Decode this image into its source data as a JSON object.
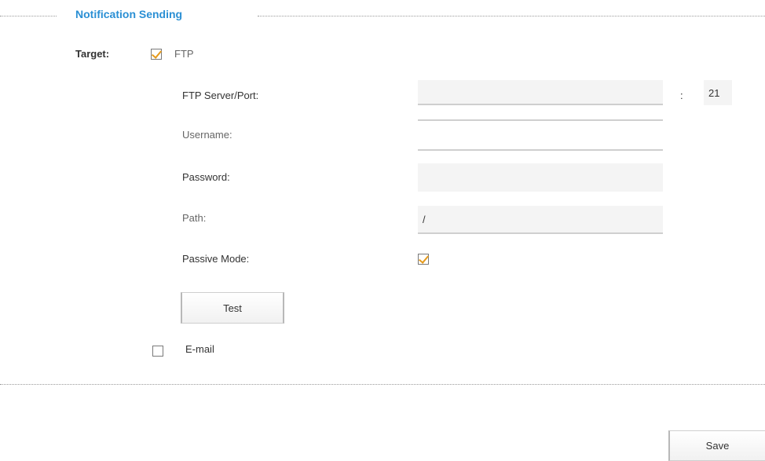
{
  "section": {
    "title": "Notification Sending"
  },
  "target": {
    "label": "Target:"
  },
  "ftp": {
    "label": "FTP",
    "checked": true,
    "server_port_label": "FTP Server/Port:",
    "server_value": "",
    "port_separator": ":",
    "port_value": "21",
    "username_label": "Username:",
    "username_value": "",
    "password_label": "Password:",
    "password_value": "",
    "path_label": "Path:",
    "path_value": "/",
    "passive_mode_label": "Passive Mode:",
    "passive_mode_checked": true,
    "test_button_label": "Test"
  },
  "email": {
    "label": "E-mail",
    "checked": false
  },
  "footer": {
    "save_button_label": "Save"
  },
  "colors": {
    "accent": "#2a8fd4",
    "checkmark": "#e59a1c"
  }
}
